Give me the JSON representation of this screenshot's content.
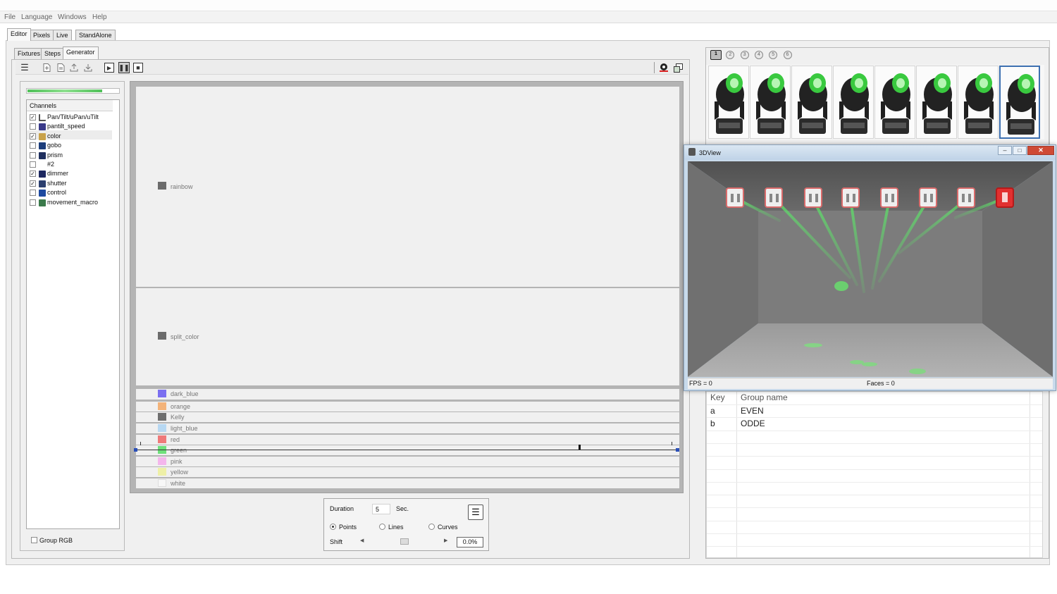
{
  "menu": [
    "File",
    "Language",
    "Windows",
    "Help"
  ],
  "main_tabs": [
    "Editor",
    "Pixels",
    "Live",
    "StandAlone"
  ],
  "sub_tabs": [
    "Fixtures",
    "Steps",
    "Generator"
  ],
  "channels": {
    "header": "Channels",
    "items": [
      {
        "label": "Pan/Tilt/uPan/uTilt",
        "checked": true
      },
      {
        "label": "pantilt_speed",
        "checked": false
      },
      {
        "label": "color",
        "checked": true
      },
      {
        "label": "gobo",
        "checked": false
      },
      {
        "label": "prism",
        "checked": false
      },
      {
        "label": "#2",
        "checked": false
      },
      {
        "label": "dimmer",
        "checked": true
      },
      {
        "label": "shutter",
        "checked": true
      },
      {
        "label": "control",
        "checked": false
      },
      {
        "label": "movement_macro",
        "checked": false
      }
    ],
    "group_rgb_label": "Group RGB"
  },
  "generator": {
    "big_rows": [
      "rainbow",
      "split_color"
    ],
    "color_rows": [
      {
        "label": "dark_blue",
        "color": "#7b6ff0"
      },
      {
        "label": "orange",
        "color": "#f3b37a"
      },
      {
        "label": "Kelly",
        "color": "#6e6e6e"
      },
      {
        "label": "light_blue",
        "color": "#b7d8f2"
      },
      {
        "label": "red",
        "color": "#ef7a7a"
      },
      {
        "label": "green",
        "color": "#6ee07b"
      },
      {
        "label": "pink",
        "color": "#f4b6ec"
      },
      {
        "label": "yellow",
        "color": "#eef0a7"
      },
      {
        "label": "white",
        "color": "#f7f7f7"
      }
    ]
  },
  "controls": {
    "duration_label": "Duration",
    "duration_value": "5",
    "duration_unit": "Sec.",
    "mode_points": "Points",
    "mode_lines": "Lines",
    "mode_curves": "Curves",
    "selected_mode": "Points",
    "shift_label": "Shift",
    "shift_value": "0.0%"
  },
  "pages": [
    "1",
    "2",
    "3",
    "4",
    "5",
    "6"
  ],
  "selected_page": "1",
  "fixtures": {
    "count": 8,
    "selected_index": 7
  },
  "view3d": {
    "title": "3DView",
    "fps": "FPS = 0",
    "faces": "Faces = 0"
  },
  "groups": {
    "headers": [
      "Key",
      "Group name"
    ],
    "rows": [
      {
        "key": "a",
        "name": "EVEN"
      },
      {
        "key": "b",
        "name": "ODDE"
      }
    ]
  }
}
